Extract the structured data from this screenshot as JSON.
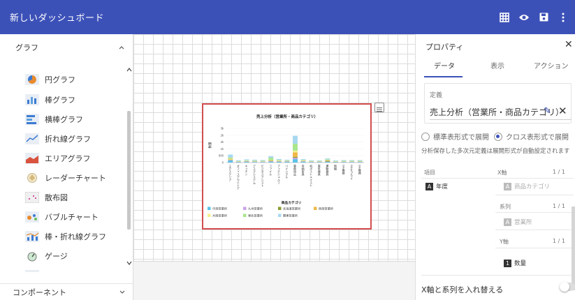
{
  "app": {
    "title": "新しいダッシュボード"
  },
  "toolbar": {
    "icons": [
      "grid-icon",
      "eye-icon",
      "save-icon",
      "more-icon"
    ]
  },
  "left_panel": {
    "section_label": "グラフ",
    "items": [
      {
        "label": "円グラフ",
        "icon": "pie-chart-icon"
      },
      {
        "label": "棒グラフ",
        "icon": "bar-chart-icon"
      },
      {
        "label": "横棒グラフ",
        "icon": "horizontal-bar-chart-icon"
      },
      {
        "label": "折れ線グラフ",
        "icon": "line-chart-icon"
      },
      {
        "label": "エリアグラフ",
        "icon": "area-chart-icon"
      },
      {
        "label": "レーダーチャート",
        "icon": "radar-chart-icon"
      },
      {
        "label": "散布図",
        "icon": "scatter-chart-icon"
      },
      {
        "label": "バブルチャート",
        "icon": "bubble-chart-icon"
      },
      {
        "label": "棒・折れ線グラフ",
        "icon": "bar-line-chart-icon"
      },
      {
        "label": "ゲージ",
        "icon": "gauge-icon"
      }
    ],
    "footer_label": "コンポーネント"
  },
  "chart_data": {
    "type": "bar",
    "title": "売上分析（営業所・商品カテゴリ）",
    "xlabel": "商品カテゴリ",
    "ylabel": "数量",
    "y_ticks": [
      "3k",
      "2k",
      "2k",
      "1k",
      "800",
      "0"
    ],
    "categories": [
      "エクステリア",
      "オフィスアウトドア",
      "キッチン",
      "アスクシステム",
      "ビジネスアシスト",
      "ファイル",
      "ブックシェルフ",
      "バイシクル",
      "事務用品",
      "収納家具",
      "机ポストメイスト",
      "電気器具",
      "運動器具",
      "無機",
      "OA機器",
      "OAサプライ",
      "OA機器"
    ],
    "series": [
      {
        "name": "中部営業所",
        "color": "#5bc3e8",
        "values": [
          180,
          40,
          60,
          50,
          40,
          80,
          60,
          60,
          300,
          80,
          40,
          40,
          60,
          30,
          40,
          40,
          40
        ]
      },
      {
        "name": "九州営業所",
        "color": "#c9a3e8",
        "values": [
          40,
          20,
          30,
          30,
          30,
          40,
          30,
          40,
          120,
          30,
          20,
          20,
          30,
          20,
          20,
          20,
          20
        ]
      },
      {
        "name": "北海道営業所",
        "color": "#8a9c2e",
        "values": [
          20,
          10,
          20,
          10,
          10,
          30,
          20,
          10,
          80,
          20,
          10,
          10,
          60,
          10,
          10,
          10,
          10
        ]
      },
      {
        "name": "西部営業所",
        "color": "#f0b84a",
        "values": [
          40,
          20,
          20,
          20,
          20,
          30,
          30,
          20,
          400,
          30,
          20,
          20,
          40,
          20,
          20,
          20,
          20
        ]
      },
      {
        "name": "大阪営業所",
        "color": "#f6f08f",
        "values": [
          60,
          20,
          30,
          30,
          20,
          40,
          30,
          20,
          150,
          30,
          20,
          20,
          30,
          20,
          20,
          20,
          20
        ]
      },
      {
        "name": "東北営業所",
        "color": "#a8e68c",
        "values": [
          100,
          30,
          40,
          40,
          40,
          200,
          60,
          40,
          600,
          40,
          30,
          30,
          60,
          30,
          40,
          40,
          40
        ]
      },
      {
        "name": "関東営業所",
        "color": "#a8d8f0",
        "values": [
          260,
          60,
          80,
          70,
          60,
          140,
          80,
          60,
          700,
          70,
          60,
          50,
          80,
          60,
          60,
          60,
          60
        ]
      }
    ],
    "ylim": [
      0,
      3000
    ],
    "legend": "bottom"
  },
  "right_panel": {
    "title": "プロパティ",
    "tabs": [
      "データ",
      "表示",
      "アクション"
    ],
    "definition_label": "定義",
    "definition_value": "売上分析（営業所・商品カテゴリ）",
    "radio_standard": "標準表形式で展開",
    "radio_cross": "クロス表形式で展開",
    "note": "分析保存した多次元定義は展開形式が自動設定されます",
    "fields": {
      "item_label": "項目",
      "xaxis_label": "X軸",
      "series_label": "系列",
      "yaxis_label": "Y軸",
      "page_xaxis": "1 / 1",
      "page_series": "1 / 1",
      "page_yaxis": "1 / 1",
      "item_year": "年度",
      "xaxis_value": "商品カテゴリ",
      "series_value": "営業所",
      "yaxis_value": "数量"
    },
    "swap_label": "X軸と系列を入れ替える"
  }
}
